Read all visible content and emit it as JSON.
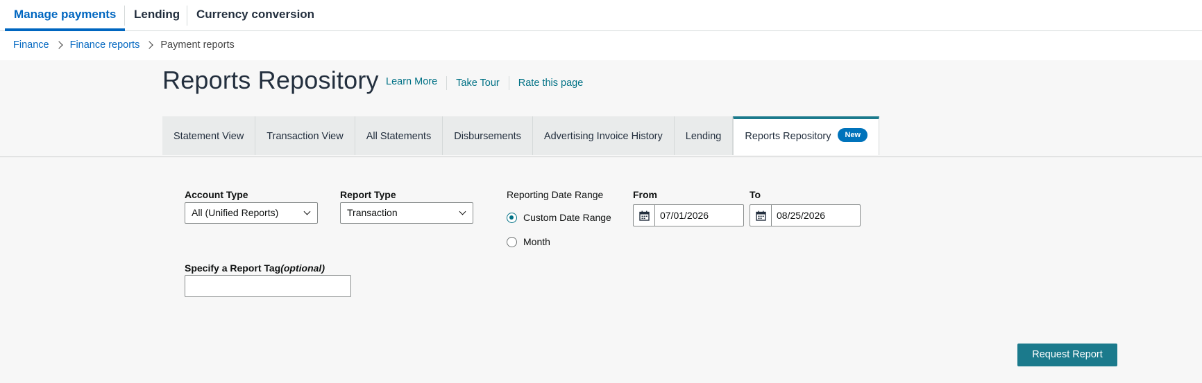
{
  "top_nav": {
    "tabs": [
      {
        "label": "Manage payments",
        "active": true
      },
      {
        "label": "Lending",
        "active": false
      },
      {
        "label": "Currency conversion",
        "active": false
      }
    ]
  },
  "breadcrumb": {
    "items": [
      "Finance",
      "Finance reports",
      "Payment reports"
    ]
  },
  "header": {
    "title": "Reports Repository",
    "links": [
      "Learn More",
      "Take Tour",
      "Rate this page"
    ]
  },
  "sub_tabs": {
    "items": [
      {
        "label": "Statement View"
      },
      {
        "label": "Transaction View"
      },
      {
        "label": "All Statements"
      },
      {
        "label": "Disbursements"
      },
      {
        "label": "Advertising Invoice History"
      },
      {
        "label": "Lending"
      },
      {
        "label": "Reports Repository",
        "badge": "New",
        "active": true
      }
    ]
  },
  "form": {
    "account_type": {
      "label": "Account Type",
      "value": "All (Unified Reports)"
    },
    "report_type": {
      "label": "Report Type",
      "value": "Transaction"
    },
    "date_range": {
      "label": "Reporting Date Range",
      "options": [
        {
          "label": "Custom Date Range",
          "checked": true
        },
        {
          "label": "Month",
          "checked": false
        }
      ]
    },
    "from": {
      "label": "From",
      "value": "07/01/2026"
    },
    "to": {
      "label": "To",
      "value": "08/25/2026"
    },
    "report_tag": {
      "label": "Specify a Report Tag",
      "optional": "(optional)",
      "value": ""
    },
    "submit_label": "Request Report"
  },
  "colors": {
    "accent_blue": "#0066c0",
    "teal": "#007185",
    "button": "#1b7a8c",
    "badge": "#0073bb"
  }
}
